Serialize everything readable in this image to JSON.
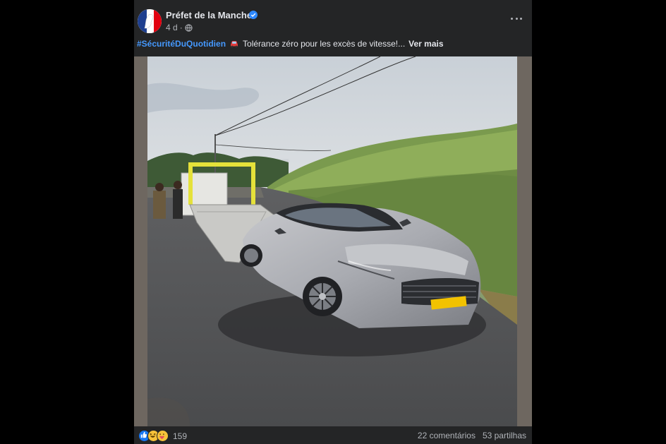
{
  "post": {
    "author": "Préfet de la Manche",
    "time": "4 d",
    "hashtag": "#SécuritéDuQuotidien",
    "text": "Tolérance zéro pour les excès de vitesse!...",
    "see_more": "Ver mais",
    "reaction_count": "159",
    "comments": "22 comentários",
    "shares": "53 partilhas",
    "icons": [
      "globe-icon",
      "verified-badge-icon",
      "more-options-icon",
      "car-emoji-icon",
      "like-reaction-icon",
      "haha-reaction-icon",
      "care-reaction-icon"
    ],
    "colors": {
      "background": "#242526",
      "hashtag": "#4599ff",
      "muted": "#b0b3b8",
      "verified": "#2d88ff"
    }
  }
}
